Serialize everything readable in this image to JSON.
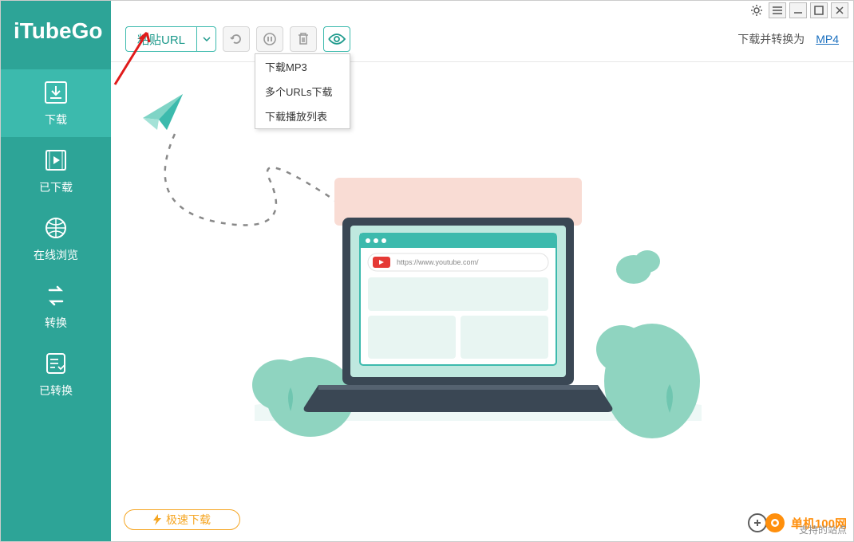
{
  "brand": "iTubeGo",
  "sidebar": {
    "items": [
      {
        "label": "下载",
        "icon": "download-icon"
      },
      {
        "label": "已下载",
        "icon": "video-file-icon"
      },
      {
        "label": "在线浏览",
        "icon": "globe-icon"
      },
      {
        "label": "转换",
        "icon": "convert-icon"
      },
      {
        "label": "已转换",
        "icon": "checklist-icon"
      }
    ]
  },
  "titlebar": {
    "settings": "gear-icon",
    "menu": "menu-icon",
    "minimize": "minimize-icon",
    "maximize": "maximize-icon",
    "close": "close-icon"
  },
  "toolbar": {
    "paste_label": "粘贴URL",
    "dropdown": [
      "下载MP3",
      "多个URLs下载",
      "下载播放列表"
    ],
    "undo": "undo-icon",
    "pause": "pause-icon",
    "delete": "trash-icon",
    "preview": "eye-icon",
    "convert_label": "下载并转换为",
    "convert_format": "MP4"
  },
  "illustration": {
    "url": "https://www.youtube.com/"
  },
  "footer": {
    "turbo_label": "极速下载"
  },
  "watermark": {
    "text": "单机100网",
    "sub": "支持的站点"
  }
}
